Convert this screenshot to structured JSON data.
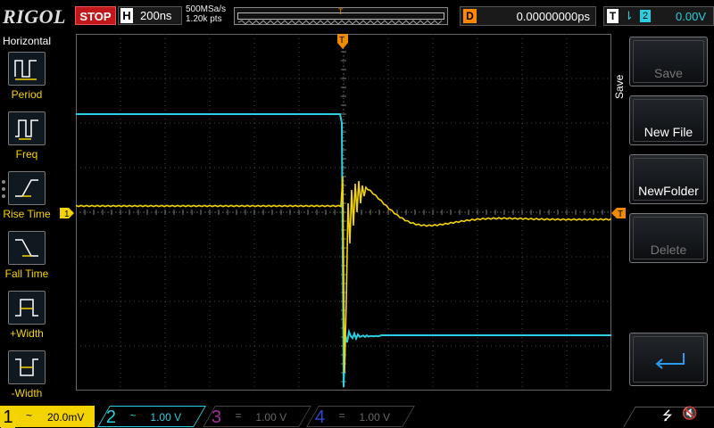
{
  "brand": "RIGOL",
  "status": "STOP",
  "timebase": {
    "label": "H",
    "value": "200ns"
  },
  "sample": {
    "rate": "500MSa/s",
    "points": "1.20k pts"
  },
  "delay": {
    "label": "D",
    "value": "0.00000000ps"
  },
  "trigger": {
    "label": "T",
    "source": "2",
    "level": "0.00V"
  },
  "left_panel": {
    "title": "Horizontal",
    "items": [
      {
        "label": "Period",
        "icon": "period-measure-icon"
      },
      {
        "label": "Freq",
        "icon": "frequency-measure-icon"
      },
      {
        "label": "Rise Time",
        "icon": "rise-time-icon"
      },
      {
        "label": "Fall Time",
        "icon": "fall-time-icon"
      },
      {
        "label": "+Width",
        "icon": "positive-width-icon"
      },
      {
        "label": "-Width",
        "icon": "negative-width-icon"
      }
    ]
  },
  "right_menu": {
    "title": "Save",
    "buttons": [
      {
        "label": "Save",
        "enabled": false
      },
      {
        "label": "New File",
        "enabled": true
      },
      {
        "label": "NewFolder",
        "enabled": true
      },
      {
        "label": "Delete",
        "enabled": false
      },
      {
        "label": "",
        "icon": "enter-return-icon",
        "enabled": true
      }
    ]
  },
  "channels": [
    {
      "num": "1",
      "coupling": "~",
      "scale": "20.0mV",
      "active": true,
      "color": "#f4d400"
    },
    {
      "num": "2",
      "coupling": "~",
      "scale": "1.00 V",
      "active": true,
      "color": "#2ad0e0"
    },
    {
      "num": "3",
      "coupling": "=",
      "scale": "1.00 V",
      "active": false,
      "color": "#a0309a"
    },
    {
      "num": "4",
      "coupling": "=",
      "scale": "1.00 V",
      "active": false,
      "color": "#2a4bd0"
    }
  ],
  "markers": {
    "ch1_level": "1",
    "trigger_level": "T",
    "trigger_position": "T"
  },
  "colors": {
    "ch1": "#f4d400",
    "ch2": "#2ad0e0",
    "trigger": "#f08a00",
    "grid": "#555555"
  }
}
